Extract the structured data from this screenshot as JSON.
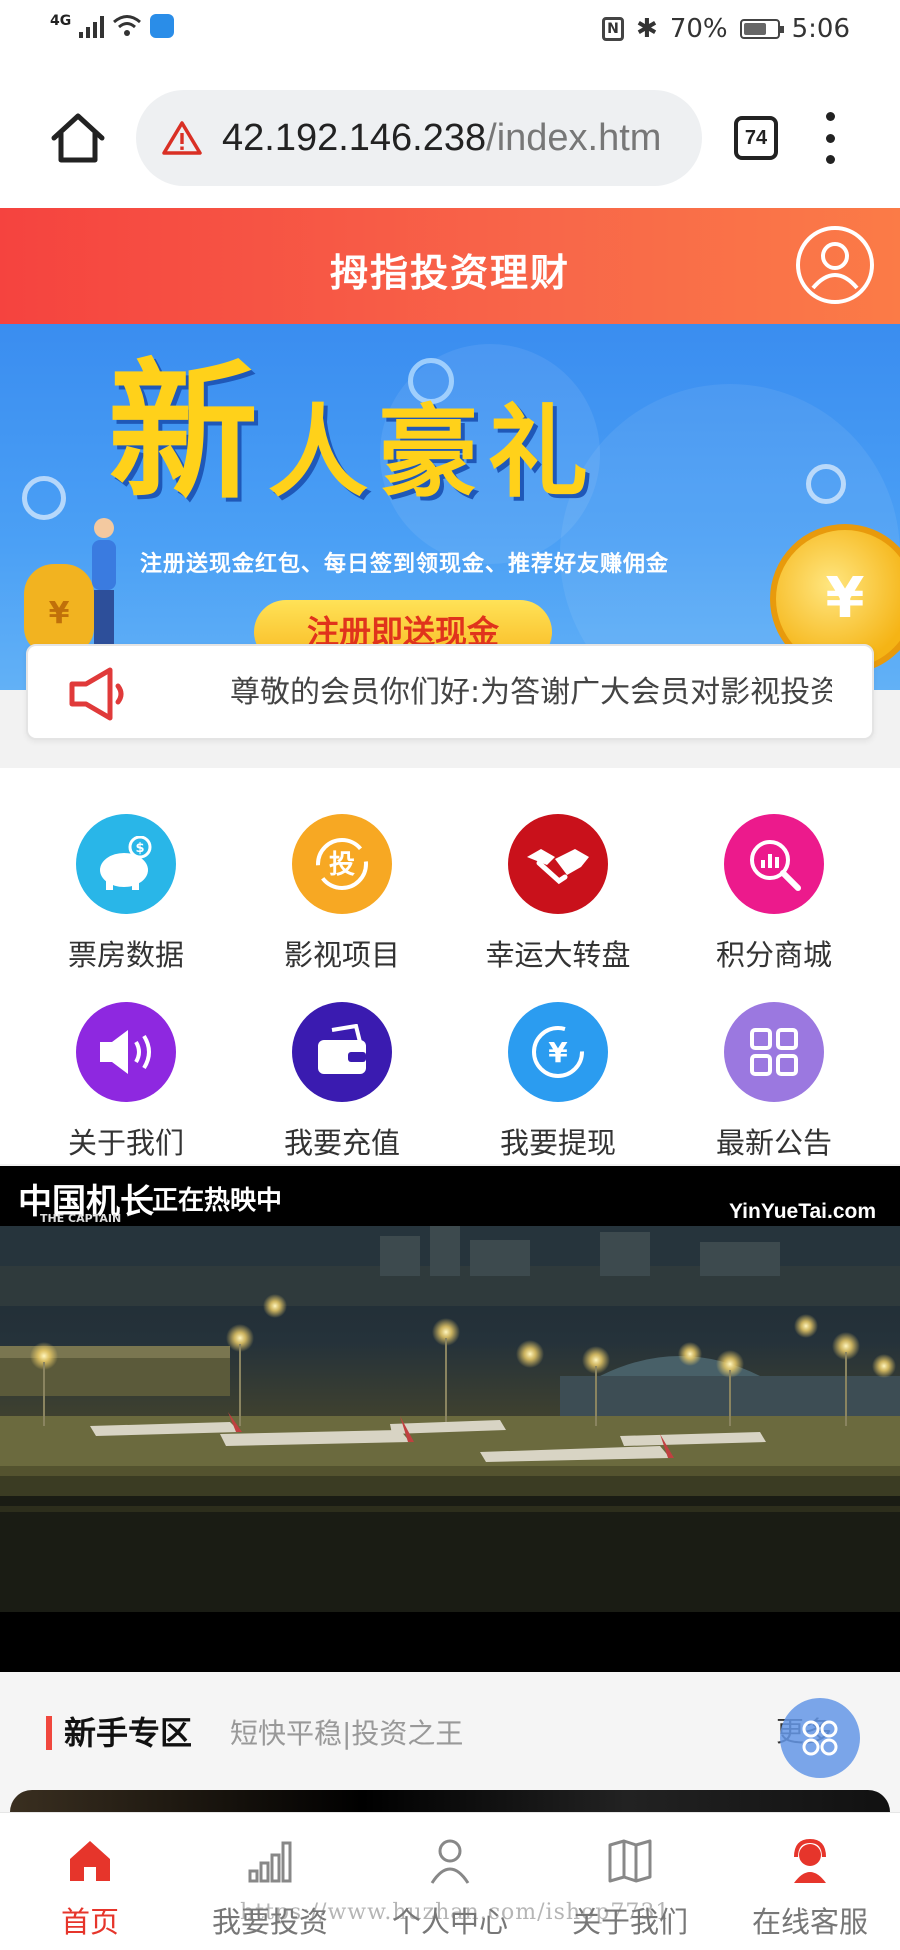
{
  "status_bar": {
    "network": "4G",
    "battery_text": "70%",
    "battery_level": 0.7,
    "time": "5:06"
  },
  "browser": {
    "url_host": "42.192.146.238",
    "url_path": "/index.htm",
    "tab_count": "74"
  },
  "app": {
    "title": "拇指投资理财"
  },
  "banner": {
    "headline": [
      "新",
      "人",
      "豪",
      "礼"
    ],
    "subtitle": "注册送现金红包、每日签到领现金、推荐好友赚佣金",
    "cta": "注册即送现金",
    "coin_symbol": "¥"
  },
  "notice": {
    "text": "尊敬的会员你们好:为答谢广大会员对影视投资的支持"
  },
  "menu_grid": [
    {
      "label": "票房数据",
      "icon": "piggy-bank-icon",
      "color": "#29b6e8"
    },
    {
      "label": "影视项目",
      "icon": "invest-icon",
      "color": "#f7a823"
    },
    {
      "label": "幸运大转盘",
      "icon": "handshake-icon",
      "color": "#c9111b"
    },
    {
      "label": "积分商城",
      "icon": "chart-search-icon",
      "color": "#ec1a8c"
    },
    {
      "label": "关于我们",
      "icon": "speaker-icon",
      "color": "#8e28e0"
    },
    {
      "label": "我要充值",
      "icon": "wallet-icon",
      "color": "#3a1bb0"
    },
    {
      "label": "我要提现",
      "icon": "yen-cycle-icon",
      "color": "#2b9cf0"
    },
    {
      "label": "最新公告",
      "icon": "grid-icon",
      "color": "#9b78e0"
    }
  ],
  "video": {
    "movie_title": "中国机长",
    "movie_title_en": "THE CAPTAIN",
    "status": "正在热映中",
    "watermark": "YinYueTai.com"
  },
  "newbie_section": {
    "title": "新手专区",
    "subtitle": "短快平稳|投资之王",
    "more": "更多"
  },
  "bottom_nav": [
    {
      "label": "首页",
      "icon": "home-icon",
      "active": true
    },
    {
      "label": "我要投资",
      "icon": "bar-chart-icon",
      "active": false
    },
    {
      "label": "个人中心",
      "icon": "user-icon",
      "active": false
    },
    {
      "label": "关于我们",
      "icon": "book-icon",
      "active": false
    },
    {
      "label": "在线客服",
      "icon": "customer-service-icon",
      "active": false
    }
  ],
  "watermark_url": "https://www.huzhan.com/ishop7731",
  "colors": {
    "brand_red": "#f5433f",
    "active_red": "#e6352b",
    "banner_blue": "#3a8df0",
    "banner_yellow": "#ffd11a"
  }
}
